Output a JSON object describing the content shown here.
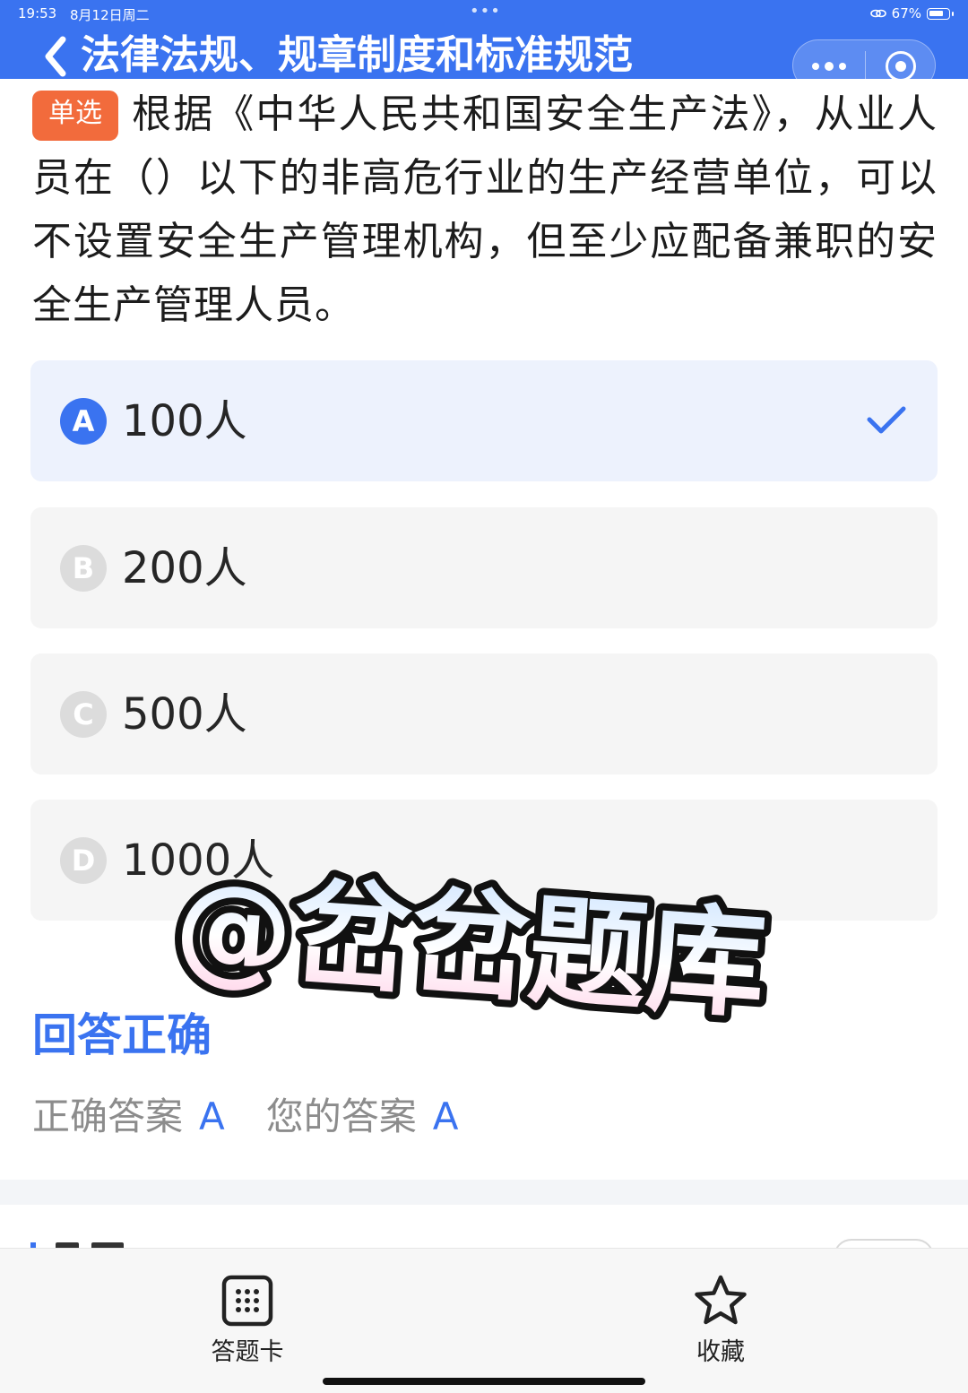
{
  "status_bar": {
    "time": "19:53",
    "date": "8月12日周二",
    "battery": "67%"
  },
  "header": {
    "title": "法律法规、规章制度和标准规范",
    "back_icon": "chevron-left-icon",
    "more_icon": "more-dots-icon",
    "close_icon": "target-circle-icon",
    "background_color": "#3a73f0"
  },
  "question": {
    "type_badge": "单选",
    "badge_color": "#f26b3c",
    "text": "根据《中华人民共和国安全生产法》，从业人员在（）以下的非高危行业的生产经营单位，可以不设置安全生产管理机构，但至少应配备兼职的安全生产管理人员。"
  },
  "options": [
    {
      "letter": "A",
      "text": "100人",
      "selected": true
    },
    {
      "letter": "B",
      "text": "200人",
      "selected": false
    },
    {
      "letter": "C",
      "text": "500人",
      "selected": false
    },
    {
      "letter": "D",
      "text": "1000人",
      "selected": false
    }
  ],
  "result": {
    "title": "回答正确",
    "correct_label": "正确答案",
    "correct_answer": "A",
    "your_label": "您的答案",
    "your_answer": "A",
    "accent_color": "#3a73f0"
  },
  "watermark": {
    "text": "@岔岔题库"
  },
  "bottom_nav": {
    "answer_card_label": "答题卡",
    "answer_card_icon": "grid-card-icon",
    "favorite_label": "收藏",
    "favorite_icon": "star-icon"
  }
}
